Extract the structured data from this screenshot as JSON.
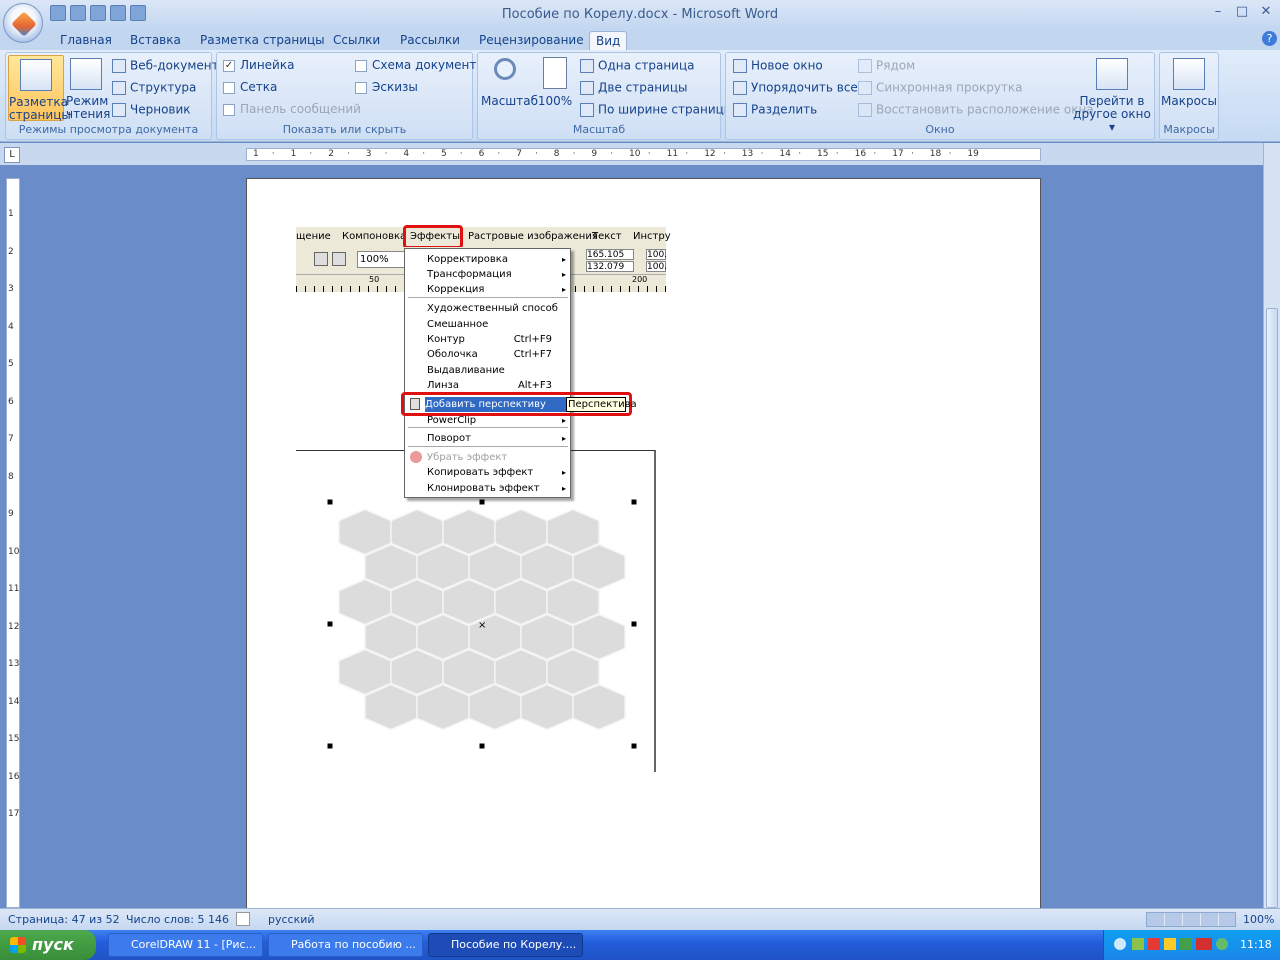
{
  "window": {
    "title": "Пособие по Корелу.docx - Microsoft Word",
    "min": "–",
    "max": "□",
    "close": "✕"
  },
  "tabs": [
    "Главная",
    "Вставка",
    "Разметка страницы",
    "Ссылки",
    "Рассылки",
    "Рецензирование",
    "Вид"
  ],
  "ribbon": {
    "views": {
      "print_layout": "Разметка страницы",
      "print_layout_l1": "Разметка",
      "print_layout_l2": "страницы",
      "reading_l1": "Режим",
      "reading_l2": "чтения",
      "web": "Веб-документ",
      "outline": "Структура",
      "draft": "Черновик",
      "group": "Режимы просмотра документа"
    },
    "show": {
      "ruler": "Линейка",
      "grid": "Сетка",
      "messages": "Панель сообщений",
      "docmap": "Схема документа",
      "thumbs": "Эскизы",
      "group": "Показать или скрыть"
    },
    "zoom": {
      "zoom": "Масштаб",
      "p100": "100%",
      "one": "Одна страница",
      "two": "Две страницы",
      "width": "По ширине страницы",
      "group": "Масштаб"
    },
    "window": {
      "new": "Новое окно",
      "arrange": "Упорядочить все",
      "split": "Разделить",
      "side": "Рядом",
      "sync": "Синхронная прокрутка",
      "reset": "Восстановить расположение окна",
      "switch_l1": "Перейти в",
      "switch_l2": "другое окно ▾",
      "group": "Окно"
    },
    "macros": {
      "label": "Макросы",
      "group": "Макросы"
    }
  },
  "ruler_nums": [
    "1",
    "·",
    "1",
    "·",
    "2",
    "·",
    "3",
    "·",
    "4",
    "·",
    "5",
    "·",
    "6",
    "·",
    "7",
    "·",
    "8",
    "·",
    "9",
    "·",
    "10",
    "·",
    "11",
    "·",
    "12",
    "·",
    "13",
    "·",
    "14",
    "·",
    "15",
    "·",
    "16",
    "·",
    "17",
    "·",
    "18",
    "·",
    "19"
  ],
  "vruler_nums": [
    "1",
    "2",
    "3",
    "4",
    "5",
    "6",
    "7",
    "8",
    "9",
    "10",
    "11",
    "12",
    "13",
    "14",
    "15",
    "16",
    "17"
  ],
  "corel": {
    "menu": [
      "щение",
      "Компоновка",
      "Эффекты",
      "Растровые изображения",
      "Текст",
      "Инстру"
    ],
    "zoom": "100%",
    "w": "165.105 м",
    "h": "132.079 м",
    "sw": "100.",
    "sh": "100.",
    "r50": "50",
    "r200": "200",
    "items": [
      {
        "label": "Корректировка",
        "sc": "",
        "arr": "▸"
      },
      {
        "label": "Трансформация",
        "sc": "",
        "arr": "▸"
      },
      {
        "label": "Коррекция",
        "sc": "",
        "arr": "▸"
      },
      {
        "label": "Художественный способ",
        "sc": "",
        "arr": ""
      },
      {
        "label": "Смешанное",
        "sc": "",
        "arr": ""
      },
      {
        "label": "Контур",
        "sc": "Ctrl+F9",
        "arr": ""
      },
      {
        "label": "Оболочка",
        "sc": "Ctrl+F7",
        "arr": ""
      },
      {
        "label": "Выдавливание",
        "sc": "",
        "arr": ""
      },
      {
        "label": "Линза",
        "sc": "Alt+F3",
        "arr": ""
      },
      {
        "label": "Добавить перспективу",
        "sc": "",
        "arr": ""
      },
      {
        "label": "PowerClip",
        "sc": "",
        "arr": "▸"
      },
      {
        "label": "Поворот",
        "sc": "",
        "arr": "▸"
      },
      {
        "label": "Убрать эффект",
        "sc": "",
        "arr": ""
      },
      {
        "label": "Копировать эффект",
        "sc": "",
        "arr": "▸"
      },
      {
        "label": "Клонировать эффект",
        "sc": "",
        "arr": "▸"
      }
    ],
    "tooltip": "Перспектива"
  },
  "status": {
    "page": "Страница: 47 из 52",
    "words": "Число слов: 5 146",
    "lang": "русский",
    "zoom": "100%"
  },
  "taskbar": {
    "start": "пуск",
    "tasks": [
      "CorelDRAW 11 - [Рис...",
      "Работа по пособию ...",
      "Пособие по Корелу...."
    ],
    "time": "11:18"
  }
}
